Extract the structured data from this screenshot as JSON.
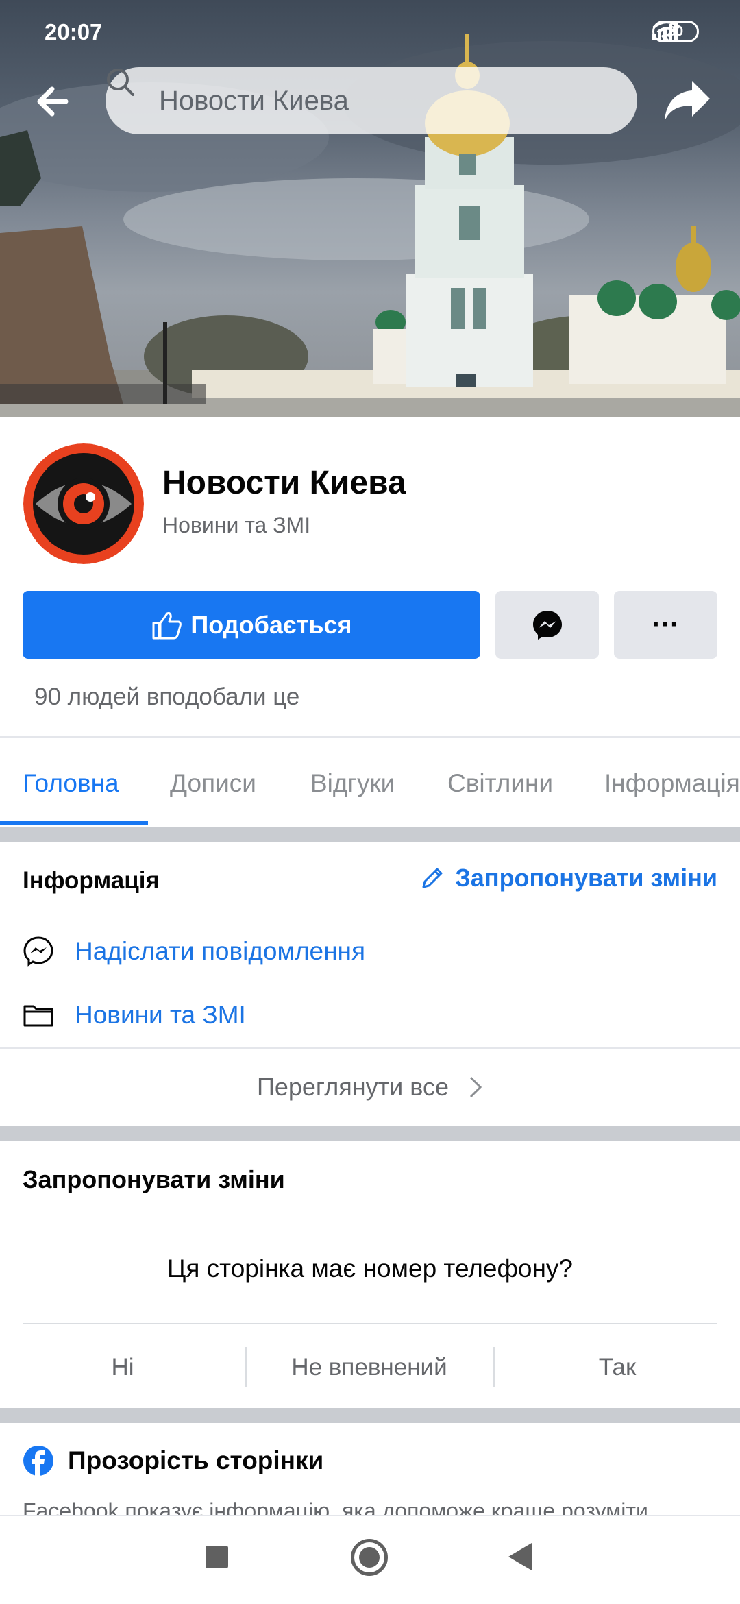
{
  "status_bar": {
    "time": "20:07",
    "battery": "30"
  },
  "header": {
    "search_text": "Новости Киева"
  },
  "profile": {
    "name": "Новости Киева",
    "category": "Новини та ЗМІ",
    "like_button": "Подобається",
    "more_button": "···",
    "likes_text": "90 людей вподобали це"
  },
  "tabs": [
    "Головна",
    "Дописи",
    "Відгуки",
    "Світлини",
    "Інформація"
  ],
  "info": {
    "title": "Інформація",
    "suggest_link": "Запропонувати зміни",
    "rows": [
      "Надіслати повідомлення",
      "Новини та ЗМІ"
    ],
    "see_all": "Переглянути все"
  },
  "suggest": {
    "title": "Запропонувати зміни",
    "question": "Ця сторінка має номер телефону?",
    "answers": [
      "Ні",
      "Не впевнений",
      "Так"
    ]
  },
  "transparency": {
    "title": "Прозорість сторінки",
    "text": "Facebook показує інформацію, яка допоможе краще розуміти"
  },
  "colors": {
    "accent": "#1877f2",
    "link": "#1b74e4",
    "button_gray": "#e4e6eb"
  }
}
